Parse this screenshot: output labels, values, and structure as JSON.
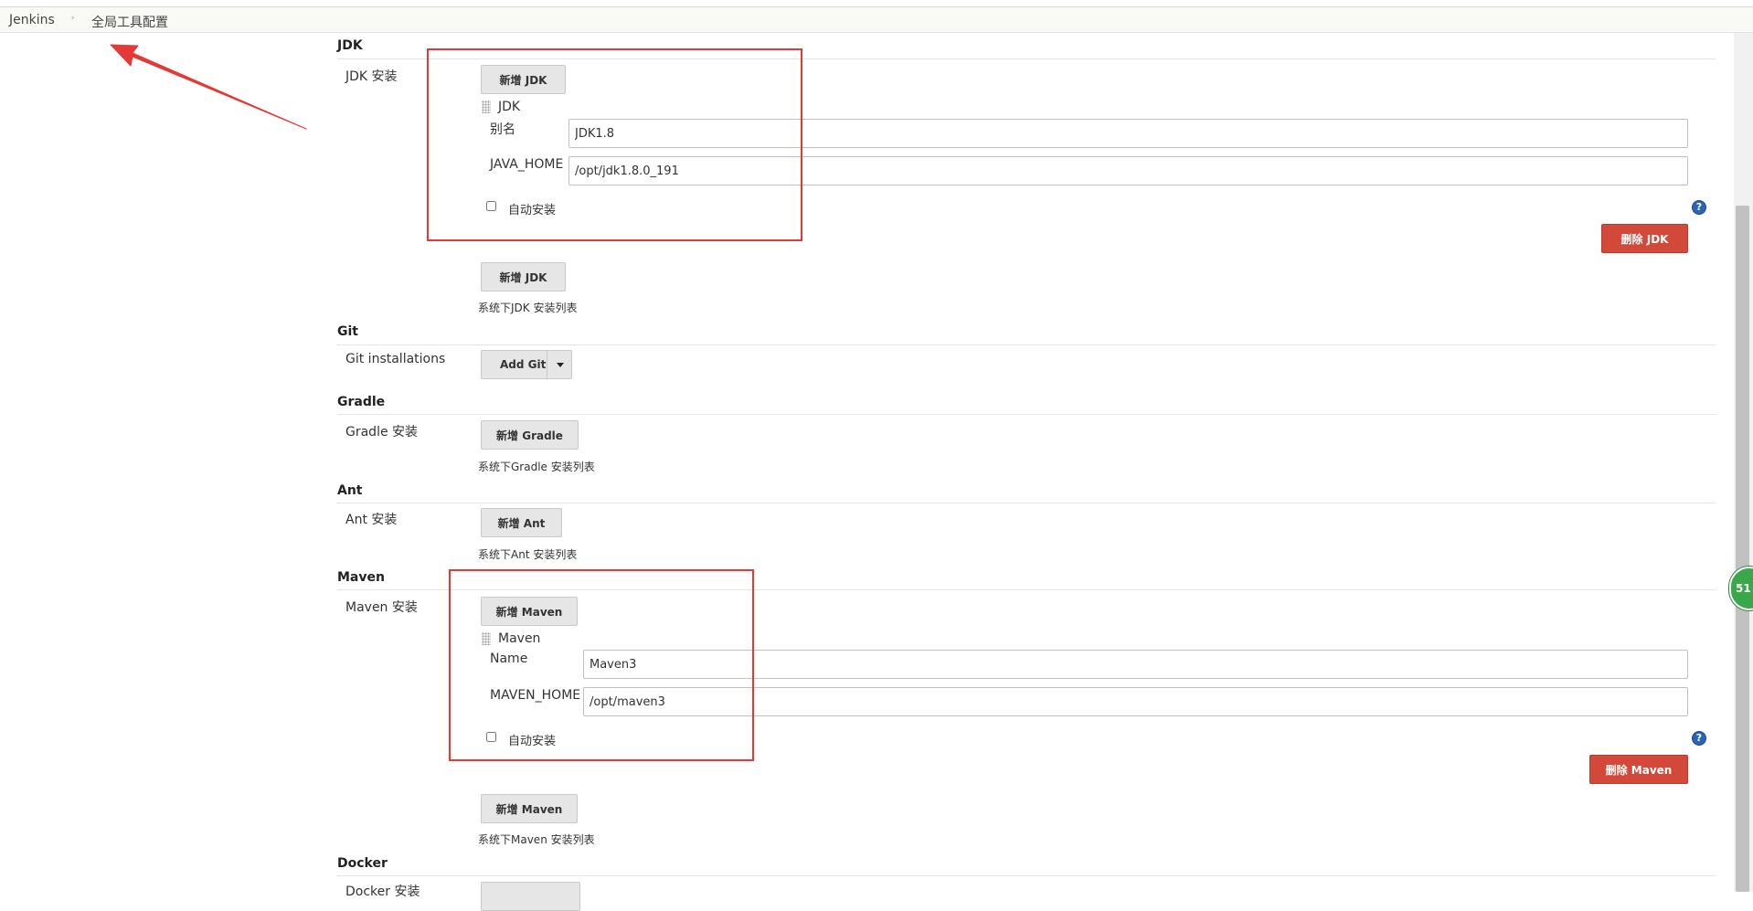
{
  "breadcrumb": {
    "root": "Jenkins",
    "separator": "›",
    "current": "全局工具配置"
  },
  "side_widget": {
    "text": "51"
  },
  "help_symbol": "?",
  "sections": {
    "jdk": {
      "title": "JDK",
      "label": "JDK 安装",
      "add_button": "新增 JDK",
      "item_title": "JDK",
      "alias_label": "别名",
      "alias_value": "JDK1.8",
      "home_label": "JAVA_HOME",
      "home_value": "/opt/jdk1.8.0_191",
      "auto_install": "自动安装",
      "delete_button": "删除 JDK",
      "hint": "系统下JDK 安装列表"
    },
    "git": {
      "title": "Git",
      "label": "Git installations",
      "add_button": "Add Git"
    },
    "gradle": {
      "title": "Gradle",
      "label": "Gradle 安装",
      "add_button": "新增 Gradle",
      "hint": "系统下Gradle 安装列表"
    },
    "ant": {
      "title": "Ant",
      "label": "Ant 安装",
      "add_button": "新增 Ant",
      "hint": "系统下Ant 安装列表"
    },
    "maven": {
      "title": "Maven",
      "label": "Maven 安装",
      "add_button": "新增 Maven",
      "item_title": "Maven",
      "name_label": "Name",
      "name_value": "Maven3",
      "home_label": "MAVEN_HOME",
      "home_value": "/opt/maven3",
      "auto_install": "自动安装",
      "delete_button": "删除 Maven",
      "hint": "系统下Maven 安装列表"
    },
    "docker": {
      "title": "Docker",
      "label": "Docker 安装"
    }
  },
  "colors": {
    "highlight": "#e53935",
    "danger": "#d24939",
    "help": "#2c63b5",
    "widget": "#3aa84a"
  },
  "icons": {
    "drag_handle": "drag-handle-icon",
    "help": "help-icon",
    "dropdown": "caret-down-icon",
    "arrow": "red-arrow-annotation"
  }
}
